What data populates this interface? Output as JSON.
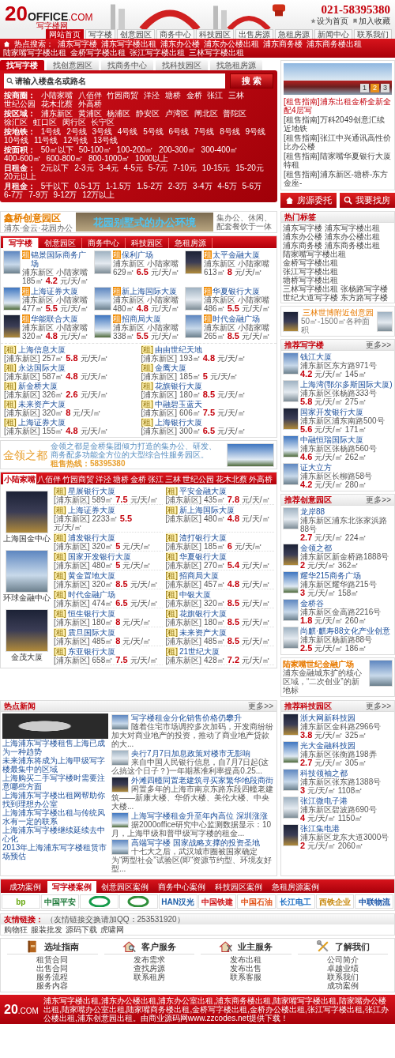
{
  "header": {
    "logo": {
      "number": "20",
      "word": "OFFICE",
      "domain": ".COM",
      "tagline": "写字楼网"
    },
    "phone": "021-58395380",
    "links": [
      "设为首页",
      "加入收藏"
    ],
    "nav": [
      {
        "label": "网站首页",
        "selected": true
      },
      {
        "label": "写字楼",
        "selected": false
      },
      {
        "label": "创意园区",
        "selected": false
      },
      {
        "label": "商务中心",
        "selected": false
      },
      {
        "label": "科技园区",
        "selected": false
      },
      {
        "label": "出售房源",
        "selected": false
      },
      {
        "label": "急租房源",
        "selected": false
      },
      {
        "label": "新闻中心",
        "selected": false
      },
      {
        "label": "联系我们",
        "selected": false
      }
    ]
  },
  "hot_search": {
    "label": "热点搜索：",
    "items": [
      "浦东写字楼",
      "浦东写字楼出租",
      "浦东办公楼",
      "浦东办公楼出租",
      "浦东商务楼",
      "浦东商务楼出租",
      "陆家嘴写字楼出租",
      "金桥写字楼出租",
      "张江写字楼出租",
      "三林写字楼出租"
    ]
  },
  "search": {
    "tabs": [
      {
        "label": "找写字楼",
        "selected": true
      },
      {
        "label": "找创意园区",
        "selected": false
      },
      {
        "label": "找商务中心",
        "selected": false
      },
      {
        "label": "找科技园区",
        "selected": false
      },
      {
        "label": "找急租房源",
        "selected": false
      }
    ],
    "placeholder": "请输入楼盘名或路名",
    "button": "搜 索",
    "filters": [
      {
        "label": "按商圈：",
        "options": [
          "小陆家嘴",
          "八佰伴",
          "竹园商贸",
          "洋泾",
          "塘桥",
          "金桥",
          "张江",
          "三林",
          "世纪公园",
          "花木北蔡",
          "外高桥"
        ]
      },
      {
        "label": "按区域：",
        "options": [
          "浦东新区",
          "黄浦区",
          "杨浦区",
          "静安区",
          "卢湾区",
          "闸北区",
          "普陀区",
          "徐汇区",
          "虹口区",
          "闵行区",
          "长宁区"
        ]
      },
      {
        "label": "按地铁：",
        "options": [
          "1号线",
          "2号线",
          "3号线",
          "4号线",
          "5号线",
          "6号线",
          "7号线",
          "8号线",
          "9号线",
          "10号线",
          "11号线",
          "12号线",
          "13号线"
        ]
      },
      {
        "label": "按面积：",
        "options": [
          "50㎡以下",
          "50-100㎡",
          "100-200㎡",
          "200-300㎡",
          "300-400㎡",
          "400-600㎡",
          "600-800㎡",
          "800-1000㎡",
          "1000以上"
        ]
      },
      {
        "label": "日租金：",
        "options": [
          "2元以下",
          "2-3元",
          "3-4元",
          "4-5元",
          "5-7元",
          "7-10元",
          "10-15元",
          "15-20元",
          "20元以上"
        ]
      },
      {
        "label": "月租金：",
        "options": [
          "5千以下",
          "0.5-1万",
          "1-1.5万",
          "1.5-2万",
          "2-3万",
          "3-4万",
          "4-5万",
          "5-6万",
          "6-7万",
          "7-9万",
          "9-12万",
          "12万以上"
        ]
      }
    ]
  },
  "slideshow": {
    "dots": [
      {
        "label": "1",
        "selected": false
      },
      {
        "label": "2",
        "selected": true
      },
      {
        "label": "3",
        "selected": false
      }
    ],
    "news": [
      {
        "category": "[租售指南]",
        "title": "浦东出租金桥全新全配4层写",
        "highlighted": true
      },
      {
        "category": "[租售指南]",
        "title": "万科2049创意汇续近地铁",
        "highlighted": false
      },
      {
        "category": "[租售指南]",
        "title": "张江中兴通讯高性价比办公楼",
        "highlighted": false
      },
      {
        "category": "[租售指南]",
        "title": "陆家嘴华夏银行大厦特租",
        "highlighted": false
      },
      {
        "category": "[租售指南]",
        "title": "浦东新区-塘桥-东方金座-",
        "highlighted": false
      }
    ]
  },
  "actions": [
    {
      "label": "房源委托",
      "kind": "house"
    },
    {
      "label": "我要找房",
      "kind": "search"
    }
  ],
  "banner_top": {
    "title": "鑫桥创意园区",
    "subtitle": "浦东·金云·花园办公",
    "slogan": "花园别墅式的办公环境",
    "text": "集办公、休闲、配套餐饮于一体"
  },
  "listings": {
    "tabs": [
      {
        "label": "写字楼",
        "selected": true
      },
      {
        "label": "创意园区",
        "selected": false
      },
      {
        "label": "商务中心",
        "selected": false
      },
      {
        "label": "科技园区",
        "selected": false
      },
      {
        "label": "急租房源",
        "selected": false
      }
    ],
    "cards": [
      {
        "tag": "租",
        "name": "锦景国际商务广场",
        "location": "浦东新区 小陆家嘴",
        "size": "185㎡",
        "price": "4.2",
        "unit": "元/天/㎡"
      },
      {
        "tag": "租",
        "name": "保利广场",
        "location": "浦东新区 小陆家嘴",
        "size": "629㎡",
        "price": "6.5",
        "unit": "元/天/㎡"
      },
      {
        "tag": "租",
        "name": "太平金融大厦",
        "location": "浦东新区 小陆家嘴",
        "size": "613㎡",
        "price": "8",
        "unit": "元/天/㎡"
      },
      {
        "tag": "租",
        "name": "上海证券大厦",
        "location": "浦东新区 小陆家嘴",
        "size": "477㎡",
        "price": "5.5",
        "unit": "元/天/㎡"
      },
      {
        "tag": "租",
        "name": "新上海国际大厦",
        "location": "浦东新区 小陆家嘴",
        "size": "480㎡",
        "price": "4.8",
        "unit": "元/天/㎡"
      },
      {
        "tag": "租",
        "name": "华夏银行大厦",
        "location": "浦东新区 小陆家嘴",
        "size": "486㎡",
        "price": "5.5",
        "unit": "元/天/㎡"
      },
      {
        "tag": "租",
        "name": "华能联合大厦",
        "location": "浦东新区 小陆家嘴",
        "size": "320㎡",
        "price": "4.8",
        "unit": "元/天/㎡"
      },
      {
        "tag": "租",
        "name": "招商局大厦",
        "location": "浦东新区 小陆家嘴",
        "size": "338㎡",
        "price": "5.5",
        "unit": "元/天/㎡"
      },
      {
        "tag": "租",
        "name": "时代金融广场",
        "location": "浦东新区 小陆家嘴",
        "size": "265㎡",
        "price": "8.5",
        "unit": "元/天/㎡"
      }
    ],
    "items": [
      {
        "tag": "[租]",
        "name": "上海信息大厦",
        "district": "[浦东新区]",
        "size": "257㎡",
        "price": "5.8",
        "unit": "元/天/㎡"
      },
      {
        "tag": "[租]",
        "name": "由由世纪天地",
        "district": "[浦东新区]",
        "size": "193㎡",
        "price": "4.8",
        "unit": "元/天/㎡"
      },
      {
        "tag": "[租]",
        "name": "永达国际大厦",
        "district": "[浦东新区]",
        "size": "587㎡",
        "price": "4.8",
        "unit": "元/天/㎡"
      },
      {
        "tag": "[租]",
        "name": "金鹰大厦",
        "district": "[浦东新区]",
        "size": "185㎡",
        "price": "5",
        "unit": "元/天/㎡"
      },
      {
        "tag": "[租]",
        "name": "新金桥大厦",
        "district": "[浦东新区]",
        "size": "326㎡",
        "price": "2.6",
        "unit": "元/天/㎡"
      },
      {
        "tag": "[租]",
        "name": "花旗银行大厦",
        "district": "[浦东新区]",
        "size": "180㎡",
        "price": "8.5",
        "unit": "元/天/㎡"
      },
      {
        "tag": "[租]",
        "name": "未来资产大厦",
        "district": "[浦东新区]",
        "size": "320㎡",
        "price": "8",
        "unit": "元/天/㎡"
      },
      {
        "tag": "[租]",
        "name": "中融碧玉蓝天",
        "district": "[浦东新区]",
        "size": "606㎡",
        "price": "7.5",
        "unit": "元/天/㎡"
      },
      {
        "tag": "[租]",
        "name": "上海证券大厦",
        "district": "[浦东新区]",
        "size": "155㎡",
        "price": "4.8",
        "unit": "元/天/㎡"
      },
      {
        "tag": "[租]",
        "name": "上海银行大厦",
        "district": "[浦东新区]",
        "size": "300㎡",
        "price": "6.5",
        "unit": "元/天/㎡"
      }
    ]
  },
  "banner_mid": {
    "title": "金领之都",
    "text": "金领之都是金桥集团倾力打造的集办公、研发、商务配多功能全方位的大型综合性服务园区。",
    "hotline": "租售热线：58395380"
  },
  "district_listings": {
    "tabs": [
      {
        "label": "小陆家嘴",
        "selected": true
      },
      {
        "label": "八佰伴",
        "selected": false
      },
      {
        "label": "竹园商贸",
        "selected": false
      },
      {
        "label": "洋泾",
        "selected": false
      },
      {
        "label": "塘桥",
        "selected": false
      },
      {
        "label": "金桥",
        "selected": false
      },
      {
        "label": "张江",
        "selected": false
      },
      {
        "label": "三林",
        "selected": false
      },
      {
        "label": "世纪公园",
        "selected": false
      },
      {
        "label": "花木北蔡",
        "selected": false
      },
      {
        "label": "外高桥",
        "selected": false
      }
    ],
    "featured": [
      "上海国金中心",
      "环球金融中心",
      "金茂大厦"
    ],
    "items": [
      {
        "tag": "[租]",
        "name": "星展银行大厦",
        "district": "[浦东新区]",
        "size": "589㎡",
        "price": "7.5",
        "unit": "元/天/㎡"
      },
      {
        "tag": "[租]",
        "name": "平安金融大厦",
        "district": "[浦东新区]",
        "size": "435㎡",
        "price": "7.8",
        "unit": "元/天/㎡"
      },
      {
        "tag": "[租]",
        "name": "上海证券大厦",
        "district": "[浦东新区]",
        "size": "2233㎡",
        "price": "5.5",
        "unit": "元/天/㎡"
      },
      {
        "tag": "[租]",
        "name": "新上海国际大厦",
        "district": "[浦东新区]",
        "size": "480㎡",
        "price": "4.8",
        "unit": "元/天/㎡"
      },
      {
        "tag": "[租]",
        "name": "浦发银行大厦",
        "district": "[浦东新区]",
        "size": "320㎡",
        "price": "5",
        "unit": "元/天/㎡"
      },
      {
        "tag": "[租]",
        "name": "渣打银行大厦",
        "district": "[浦东新区]",
        "size": "185㎡",
        "price": "6",
        "unit": "元/天/㎡"
      },
      {
        "tag": "[租]",
        "name": "国家开发银行大厦",
        "district": "[浦东新区]",
        "size": "480㎡",
        "price": "5",
        "unit": "元/天/㎡"
      },
      {
        "tag": "[租]",
        "name": "华夏银行大厦",
        "district": "[浦东新区]",
        "size": "270㎡",
        "price": "5.4",
        "unit": "元/天/㎡"
      },
      {
        "tag": "[租]",
        "name": "黄金置地大厦",
        "district": "[浦东新区]",
        "size": "320㎡",
        "price": "8.5",
        "unit": "元/天/㎡"
      },
      {
        "tag": "[租]",
        "name": "招商局大厦",
        "district": "[浦东新区]",
        "size": "457㎡",
        "price": "4.8",
        "unit": "元/天/㎡"
      },
      {
        "tag": "[租]",
        "name": "时代金融广场",
        "district": "[浦东新区]",
        "size": "474㎡",
        "price": "6.5",
        "unit": "元/天/㎡"
      },
      {
        "tag": "[租]",
        "name": "中银大厦",
        "district": "[浦东新区]",
        "size": "320㎡",
        "price": "8.5",
        "unit": "元/天/㎡"
      },
      {
        "tag": "[租]",
        "name": "恒生银行大厦",
        "district": "[浦东新区]",
        "size": "180㎡",
        "price": "8",
        "unit": "元/天/㎡"
      },
      {
        "tag": "[租]",
        "name": "花旗银行大厦",
        "district": "[浦东新区]",
        "size": "180㎡",
        "price": "8.5",
        "unit": "元/天/㎡"
      },
      {
        "tag": "[租]",
        "name": "震旦国际大厦",
        "district": "[浦东新区]",
        "size": "485㎡",
        "price": "8",
        "unit": "元/天/㎡"
      },
      {
        "tag": "[租]",
        "name": "未来资产大厦",
        "district": "[浦东新区]",
        "size": "485㎡",
        "price": "8.5",
        "unit": "元/天/㎡"
      },
      {
        "tag": "[租]",
        "name": "东亚银行大厦",
        "district": "[浦东新区]",
        "size": "658㎡",
        "price": "7.5",
        "unit": "元/天/㎡"
      },
      {
        "tag": "[租]",
        "name": "21世纪大厦",
        "district": "[浦东新区]",
        "size": "428㎡",
        "price": "7.2",
        "unit": "元/天/㎡"
      }
    ]
  },
  "hot_tags": {
    "title": "热门标签",
    "tags": [
      "浦东写字楼",
      "浦东写字楼出租",
      "浦东办公楼",
      "浦东办公楼出租",
      "浦东商务楼",
      "浦东商务楼出租",
      "陆家嘴写字楼出租",
      "金桥写字楼出租",
      "张江写字楼出租",
      "塘桥写字楼出租",
      "三林写字楼出租",
      "张杨路写字楼",
      "世纪大道写字楼",
      "东方路写字楼"
    ]
  },
  "ad_sanlin": {
    "title": "三林世博附近创意园",
    "note": "50㎡-1500㎡各种面积"
  },
  "recommended_offices": {
    "title": "推荐写字楼",
    "more": "更多>>",
    "items": [
      {
        "name": "钱江大厦",
        "address": "浦东新区东方路971号",
        "price": "4.2",
        "unit": "元/天/㎡",
        "size": "145㎡"
      },
      {
        "name": "上海湾(鄂尔多斯国际大厦)",
        "address": "浦东新区张杨路333号",
        "price": "5.8",
        "unit": "元/天/㎡",
        "size": "275㎡"
      },
      {
        "name": "国家开发银行大厦",
        "address": "浦东新区浦东南路500号",
        "price": "5.6",
        "unit": "元/天/㎡",
        "size": "171㎡"
      },
      {
        "name": "中融恒瑞国际大厦",
        "address": "浦东新区张杨路560号",
        "price": "4.6",
        "unit": "元/天/㎡",
        "size": "262㎡"
      },
      {
        "name": "证大立方",
        "address": "浦东新区长柳路58号",
        "price": "4.2",
        "unit": "元/天/㎡",
        "size": "280㎡"
      }
    ]
  },
  "recommended_parks": {
    "title": "推荐创意园区",
    "more": "更多>>",
    "items": [
      {
        "name": "龙岸88",
        "address": "浦东新区浦东北张家浜路88号",
        "price": "2.7",
        "unit": "元/天/㎡",
        "size": "224㎡"
      },
      {
        "name": "金领之都",
        "address": "浦东新区新金桥路1888号",
        "price": "2",
        "unit": "元/天/㎡",
        "size": "362㎡"
      },
      {
        "name": "耀华215商务广场",
        "address": "浦东新区耀华路215号",
        "price": "3",
        "unit": "元/天/㎡",
        "size": "158㎡"
      },
      {
        "name": "金桥谷",
        "address": "浦东新区金高路2216号",
        "price": "1.8",
        "unit": "元/天/㎡",
        "size": "260㎡"
      },
      {
        "name": "尚麒·麒寿88文化产业创意",
        "address": "浦东新区杨新路88号",
        "price": "2.5",
        "unit": "元/天/㎡",
        "size": "186㎡"
      }
    ]
  },
  "ad_lujiazui": {
    "title": "陆家嘴世纪金融广场",
    "text": "浦东金融城东扩的核心区域，“二次创业”的新地标"
  },
  "hot_news": {
    "title": "热点新闻",
    "more": "更多>>",
    "links": [
      "上海浦东写字楼租售上海已成为一种趋势",
      "未来浦东将成为上海甲级写字楼最集中的区域",
      "上海购买二手写字楼时需要注意哪些方面",
      "上海浦东写字楼出租网帮助你找到理想办公室",
      "上海浦东写字楼出租与传统风水有一定的联系",
      "上海浦东写字楼继续延续去中心化",
      "2013年上海浦东写字楼租赁市场预估"
    ],
    "articles": [
      {
        "title": "写字楼租金分化销售价格仍攀升",
        "summary": "随着住宅市场调控多次加码，开发商纷纷加大对商业地产的投资，推动了商业地产贷款的大..."
      },
      {
        "title": "央行7月7日加息政策对楼市无影响",
        "summary": "来自中国人民银行信息，自7月7日起(这么搞这个日子？)一年期基准利率提高0.25..."
      },
      {
        "title": "外滩四幢同置老建筑寻买家繁华地段商街",
        "summary": "闲置多年的上海市南京东路东段四幢老建筑——新康大楼、华侨大楼、美伦大楼、中央大楼..."
      },
      {
        "title": "上海写字楼租金升至年内高位 深圳涨涨",
        "summary": "据2000office研究中心监测数据显示：10月，上海甲级和普甲级写字楼的租金..."
      },
      {
        "title": "高端写字楼 国家战略支撑的投资圣地",
        "summary": "十七大之后，武汉城市圈被国家确定为“两型社会”试验区(即“资源节约型、环境友好型..."
      }
    ]
  },
  "tech_parks": {
    "title": "推荐科技园区",
    "more": "更多>>",
    "items": [
      {
        "name": "浙大网新科技园",
        "address": "浦东新区金科路2966号",
        "price": "3.8",
        "unit": "元/天/㎡",
        "size": "325㎡"
      },
      {
        "name": "光大金融科技园",
        "address": "浦东新区张衡路198弄",
        "price": "2.7",
        "unit": "元/天/㎡",
        "size": "305㎡"
      },
      {
        "name": "科技领袖之都",
        "address": "浦东新区张东路1388号",
        "price": "3",
        "unit": "元/天/㎡",
        "size": "1108㎡"
      },
      {
        "name": "张江微电子港",
        "address": "浦东新区碧波路690号",
        "price": "4",
        "unit": "元/天/㎡",
        "size": "1150㎡"
      },
      {
        "name": "张江集电港",
        "address": "浦东新区龙东大道3000号",
        "price": "2",
        "unit": "元/天/㎡",
        "size": "2060㎡"
      }
    ]
  },
  "cases": {
    "label": "成功案例",
    "tabs": [
      {
        "label": "写字楼案例",
        "selected": true
      },
      {
        "label": "创意园区案例",
        "selected": false
      },
      {
        "label": "商务中心案例",
        "selected": false
      },
      {
        "label": "科技园区案例",
        "selected": false
      },
      {
        "label": "急租房源案例",
        "selected": false
      }
    ],
    "logos": [
      {
        "kind": "text",
        "text": "bp",
        "color": "#66a80f"
      },
      {
        "kind": "text",
        "text": "中国平安",
        "color": "#1f7a3a"
      },
      {
        "kind": "emblem",
        "color": "#159b4a"
      },
      {
        "kind": "emblem",
        "color": "#2f8f3a"
      },
      {
        "kind": "text",
        "text": "HAN汉光",
        "color": "#1d5fa8"
      },
      {
        "kind": "text",
        "text": "中国铁建",
        "color": "#d0161b"
      },
      {
        "kind": "text",
        "text": "中国石油",
        "color": "#e0541a"
      },
      {
        "kind": "text",
        "text": "长江电工",
        "color": "#1d6fc2"
      },
      {
        "kind": "text",
        "text": "西铁企业",
        "color": "#c88a10"
      },
      {
        "kind": "text",
        "text": "中联物流",
        "color": "#1b55a8"
      }
    ]
  },
  "friend_links": {
    "label": "友情链接：",
    "note": "（友情链接交换请加QQ：253531920）",
    "links": [
      "购物狂",
      "服装批发",
      "源码下载",
      "虎啸网"
    ]
  },
  "footer_columns": [
    {
      "kind": "book",
      "title": "选址指南",
      "links": [
        "租赁合同",
        "出售合同",
        "服务流程",
        "服务内容"
      ]
    },
    {
      "kind": "house-search",
      "title": "客户服务",
      "links": [
        "发布需求",
        "查找房源",
        "联系租房"
      ]
    },
    {
      "kind": "house-tools",
      "title": "业主服务",
      "links": [
        "发布出租",
        "发布出售",
        "联系客服"
      ]
    },
    {
      "kind": "tools",
      "title": "了解我们",
      "links": [
        "公司简介",
        "卓越业绩",
        "联系我们",
        "成功案例"
      ]
    }
  ],
  "footer": {
    "number": "20",
    "domain": ".COM",
    "text": "浦东写字楼出租,浦东办公楼出租,浦东办公室出租,浦东商务楼出租,陆家嘴写字楼出租,陆家嘴办公楼出租,陆家嘴办公室出租,陆家嘴商务楼出租,金桥写字楼出租,金桥办公楼出租,张江写字楼出租,张江办公楼出租,浦东创意园出租。由商业源码网www.zzcodes.net提供下载！"
  }
}
